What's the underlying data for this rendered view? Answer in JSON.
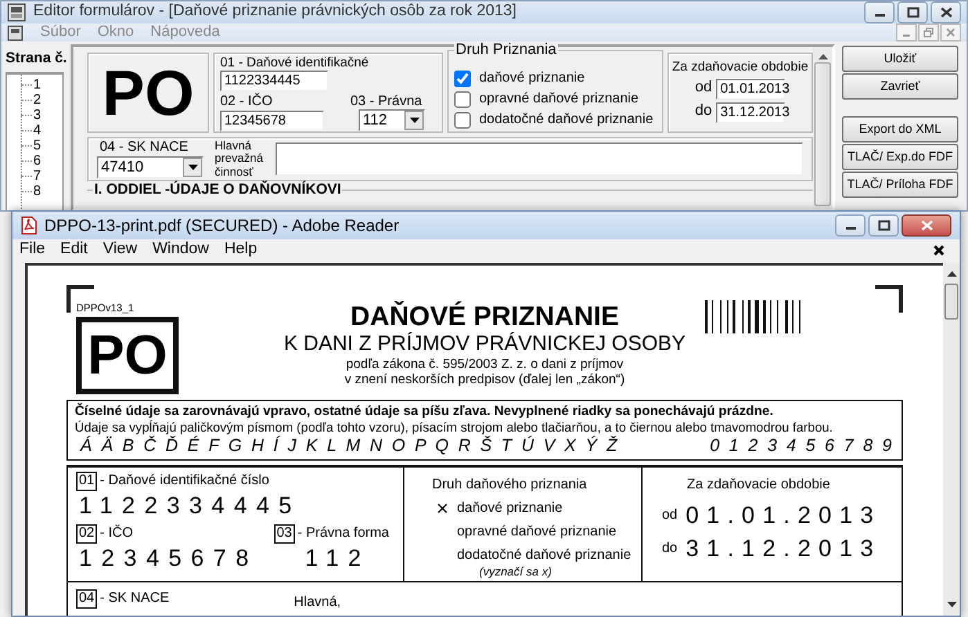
{
  "editor_window": {
    "title": "Editor formulárov - [Daňové priznanie právnických osôb za rok 2013]",
    "menu": [
      "Súbor",
      "Okno",
      "Nápoveda"
    ],
    "pages_panel": {
      "heading": "Strana č.",
      "items": [
        "1",
        "2",
        "3",
        "4",
        "5",
        "6",
        "7",
        "8"
      ]
    },
    "form": {
      "logo": "PO",
      "tax_id": {
        "label": "01 - Daňové identifikačné",
        "value": "1122334445"
      },
      "ico": {
        "label": "02 - IČO",
        "value": "12345678"
      },
      "legal_form": {
        "label": "03 - Právna",
        "value": "112"
      },
      "return_type": {
        "title": "Druh Priznania",
        "options": [
          {
            "label": "daňové priznanie",
            "checked": true
          },
          {
            "label": "opravné daňové priznanie",
            "checked": false
          },
          {
            "label": "dodatočné daňové priznanie",
            "checked": false
          }
        ]
      },
      "period": {
        "title": "Za zdaňovacie obdobie",
        "from_label": "od",
        "from": "01.01.2013",
        "to_label": "do",
        "to": "31.12.2013"
      },
      "nace": {
        "label": "04 - SK NACE",
        "value": "47410"
      },
      "main_activity": {
        "label": "Hlavná prevažná činnosť"
      },
      "section_title": "I. ODDIEL -ÚDAJE O DAŇOVNÍKOVI"
    },
    "button_groups": [
      [
        "Uložiť",
        "Zavrieť"
      ],
      [
        "Export do XML",
        "TLAČ/ Exp.do FDF",
        "TLAČ/ Príloha FDF"
      ]
    ]
  },
  "reader_window": {
    "title": "DPPO-13-print.pdf (SECURED) - Adobe Reader",
    "menu": [
      "File",
      "Edit",
      "View",
      "Window",
      "Help"
    ],
    "document": {
      "form_code": "DPPOv13_1",
      "logo": "PO",
      "title": "DAŇOVÉ PRIZNANIE",
      "subtitle": "K DANI Z PRÍJMOV PRÁVNICKEJ OSOBY",
      "law_lines": [
        "podľa zákona č. 595/2003 Z. z. o dani z príjmov",
        "v znení neskorších predpisov (ďalej len „zákon“)"
      ],
      "instructions": {
        "bold_line": "Číselné údaje sa zarovnávajú vpravo, ostatné údaje sa píšu zľava. Nevyplnené riadky sa ponechávajú prázdne.",
        "line": "Údaje sa vypĺňajú paličkovým písmom (podľa tohto vzoru), písacím strojom alebo tlačiarňou, a to čiernou alebo tmavomodrou farbou.",
        "letters": "Á Ä B Č Ď É F G H Í J K L M N O P Q R Š T Ú V X Ý Ž",
        "digits": "0 1 2 3 4 5 6 7 8 9"
      },
      "tax_id": {
        "number": "01",
        "label": "- Daňové identifikačné číslo",
        "value": "1122334445"
      },
      "ico": {
        "number": "02",
        "label": "- IČO",
        "value": "12345678"
      },
      "legal_form": {
        "number": "03",
        "label": "- Právna forma",
        "value": "112"
      },
      "return_type": {
        "title": "Druh daňového priznania",
        "options": [
          {
            "label": "daňové priznanie",
            "checked": true
          },
          {
            "label": "opravné daňové priznanie",
            "checked": false
          },
          {
            "label": "dodatočné daňové priznanie",
            "checked": false
          }
        ],
        "note": "(vyznačí sa x)"
      },
      "period": {
        "title": "Za zdaňovacie obdobie",
        "from_label": "od",
        "from": "01.01.2013",
        "to_label": "do",
        "to": "31.12.2013"
      },
      "nace": {
        "number": "04",
        "label": "- SK NACE"
      },
      "main_activity": {
        "label": "Hlavná,"
      }
    }
  }
}
